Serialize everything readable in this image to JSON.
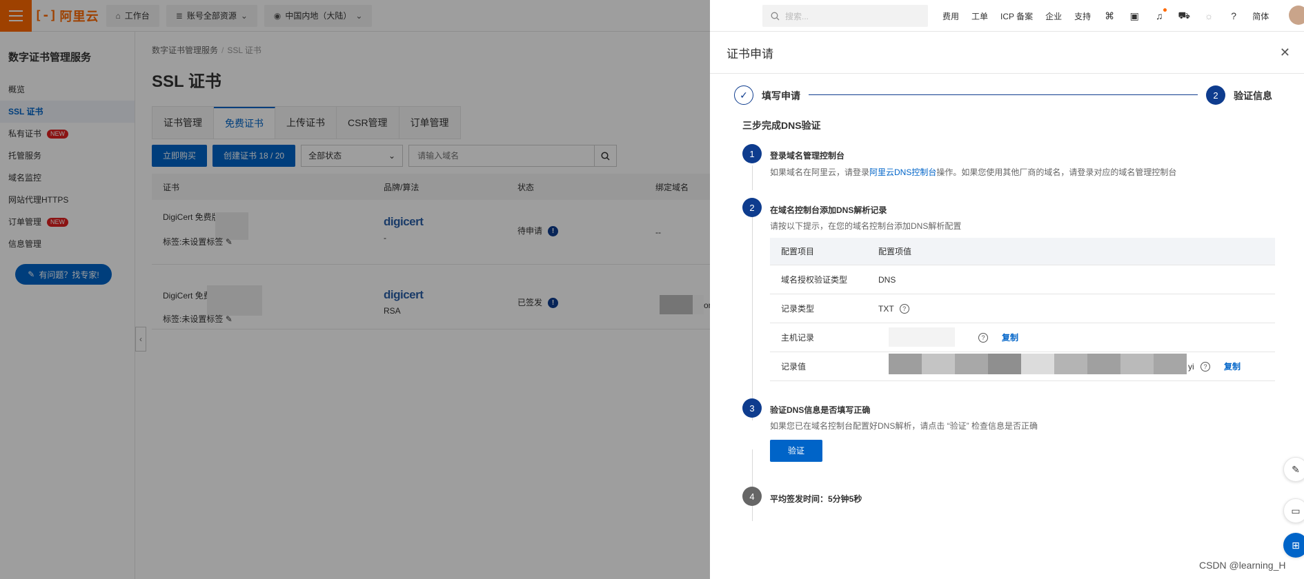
{
  "topbar": {
    "logo_text": "阿里云",
    "workbench": "工作台",
    "account_resources": "账号全部资源",
    "region": "中国内地（大陆）",
    "search_placeholder": "搜索...",
    "links": [
      "费用",
      "工单",
      "ICP 备案",
      "企业",
      "支持"
    ],
    "lang": "简体"
  },
  "sidebar": {
    "title": "数字证书管理服务",
    "items": [
      {
        "label": "概览"
      },
      {
        "label": "SSL 证书"
      },
      {
        "label": "私有证书",
        "badge": "NEW"
      },
      {
        "label": "托管服务"
      },
      {
        "label": "域名监控"
      },
      {
        "label": "网站代理HTTPS"
      },
      {
        "label": "订单管理",
        "badge": "NEW"
      },
      {
        "label": "信息管理"
      }
    ],
    "expert_button": "有问题？找专家!"
  },
  "main": {
    "breadcrumb": [
      "数字证书管理服务",
      "SSL 证书"
    ],
    "title": "SSL 证书",
    "tabs": [
      "证书管理",
      "免费证书",
      "上传证书",
      "CSR管理",
      "订单管理"
    ],
    "buy_button": "立即购买",
    "create_button": "创建证书 18 / 20",
    "status_select": "全部状态",
    "domain_placeholder": "请输入域名",
    "table": {
      "headers": [
        "证书",
        "品牌/算法",
        "状态",
        "绑定域名"
      ],
      "rows": [
        {
          "name": "DigiCert 免费版 SSL",
          "tag": "标签:未设置标签",
          "brand": "digicert",
          "algo": "-",
          "status": "待申请",
          "domain": "--"
        },
        {
          "name": "DigiCert 免费版 SSL",
          "tag": "标签:未设置标签",
          "brand": "digicert",
          "algo": "RSA",
          "status": "已签发",
          "domain": "or"
        }
      ]
    }
  },
  "drawer": {
    "title": "证书申请",
    "steps": [
      {
        "index": "✓",
        "label": "填写申请"
      },
      {
        "index": "2",
        "label": "验证信息"
      }
    ],
    "section_title": "三步完成DNS验证",
    "step1": {
      "num": "1",
      "title": "登录域名管理控制台",
      "desc_pre": "如果域名在阿里云，请登录",
      "desc_link": "阿里云DNS控制台",
      "desc_post": "操作。如果您使用其他厂商的域名，请登录对应的域名管理控制台"
    },
    "step2": {
      "num": "2",
      "title": "在域名控制台添加DNS解析记录",
      "desc": "请按以下提示，在您的域名控制台添加DNS解析配置",
      "table_headers": [
        "配置项目",
        "配置项值"
      ],
      "rows": [
        {
          "key": "域名授权验证类型",
          "value": "DNS"
        },
        {
          "key": "记录类型",
          "value": "TXT"
        },
        {
          "key": "主机记录",
          "value": "",
          "copy": "复制"
        },
        {
          "key": "记录值",
          "value": "yi",
          "copy": "复制"
        }
      ]
    },
    "step3": {
      "num": "3",
      "title": "验证DNS信息是否填写正确",
      "desc": "如果您已在域名控制台配置好DNS解析，请点击 “验证” 检查信息是否正确",
      "button": "验证"
    },
    "step4": {
      "num": "4",
      "title": "平均签发时间：5分钟5秒"
    }
  },
  "watermark": "CSDN @learning_H"
}
